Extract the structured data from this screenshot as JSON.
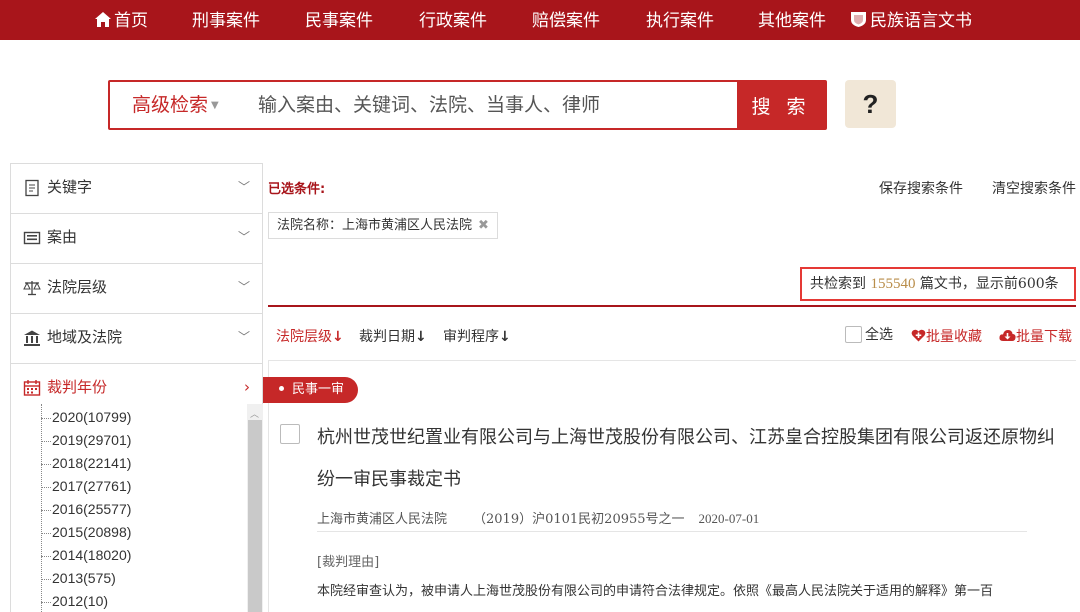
{
  "nav": {
    "items": [
      {
        "label": "首页"
      },
      {
        "label": "刑事案件"
      },
      {
        "label": "民事案件"
      },
      {
        "label": "行政案件"
      },
      {
        "label": "赔偿案件"
      },
      {
        "label": "执行案件"
      },
      {
        "label": "其他案件"
      },
      {
        "label": "民族语言文书"
      }
    ]
  },
  "search": {
    "type_label": "高级检索",
    "placeholder": "输入案由、关键词、法院、当事人、律师",
    "button_label": "搜 索",
    "help_label": "?"
  },
  "sidebar": {
    "items": [
      {
        "label": "关键字"
      },
      {
        "label": "案由"
      },
      {
        "label": "法院层级"
      },
      {
        "label": "地域及法院"
      },
      {
        "label": "裁判年份"
      }
    ],
    "years": [
      "2020(10799)",
      "2019(29701)",
      "2018(22141)",
      "2017(27761)",
      "2016(25577)",
      "2015(20898)",
      "2014(18020)",
      "2013(575)",
      "2012(10)"
    ]
  },
  "filters": {
    "selected_label": "已选条件:",
    "save_label": "保存搜索条件",
    "clear_label": "清空搜索条件",
    "tag": "法院名称：上海市黄浦区人民法院",
    "tag_close": "✖"
  },
  "results": {
    "prefix": "共检索到",
    "count": "155540",
    "suffix": "篇文书，显示前600条"
  },
  "sort": {
    "court_level": "法院层级",
    "date": "裁判日期",
    "procedure": "审判程序",
    "select_all": "全选",
    "batch_favorite": "批量收藏",
    "batch_download": "批量下载"
  },
  "card": {
    "type": "民事一审",
    "title": "杭州世茂世纪置业有限公司与上海世茂股份有限公司、江苏皇合控股集团有限公司返还原物纠纷一审民事裁定书",
    "court": "上海市黄浦区人民法院",
    "case_no": "（2019）沪0101民初20955号之一",
    "date": "2020-07-01",
    "reason_label": "[裁判理由]",
    "reason_text": "本院经审查认为，被申请人上海世茂股份有限公司的申请符合法律规定。依照《最高人民法院关于适用的解释》第一百"
  },
  "colors": {
    "brand_red": "#a8151b",
    "accent_red": "#c62828",
    "count_gold": "#b98d4a",
    "help_bg": "#f1e7d7"
  },
  "icons": [
    "home-icon",
    "emblem-icon",
    "document-icon",
    "list-icon",
    "scales-icon",
    "building-icon",
    "calendar-icon",
    "heart-plus-icon",
    "cloud-download-icon"
  ]
}
